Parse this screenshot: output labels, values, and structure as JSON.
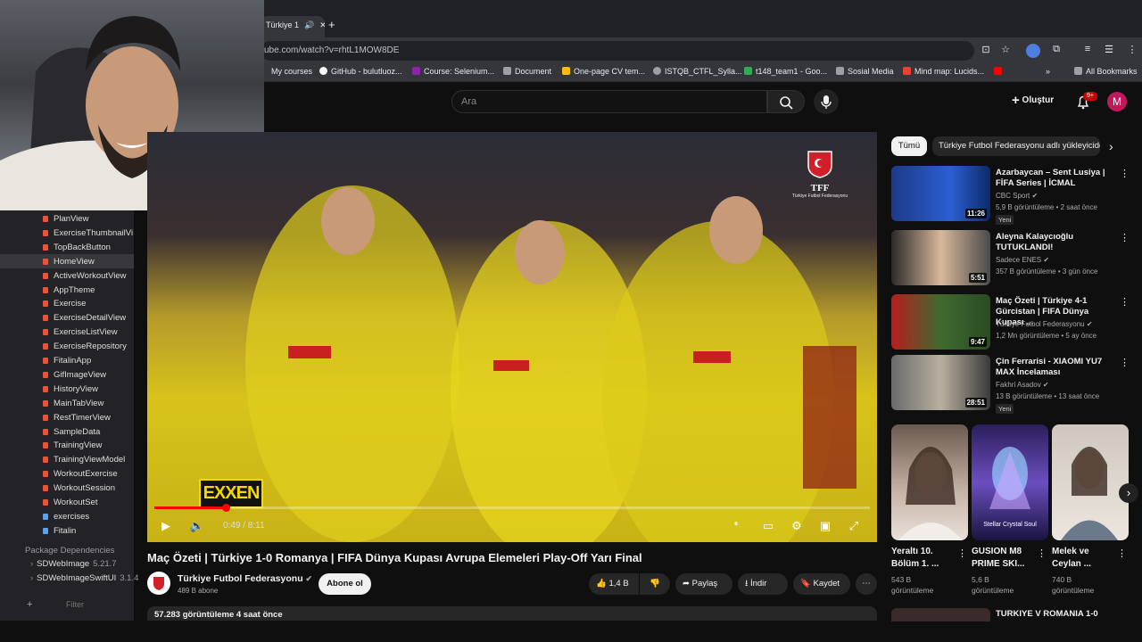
{
  "browser": {
    "tab": {
      "title": "Türkiye 1",
      "mute": "🔊",
      "close": "✕"
    },
    "new_tab": "+",
    "url": "ube.com/watch?v=rhtL1MOW8DE",
    "bookmarks": [
      {
        "label": "My courses",
        "color": "#5f6368"
      },
      {
        "label": "GitHub - bulutluoz...",
        "color": "#ffffff"
      },
      {
        "label": "Course: Selenium...",
        "color": "#8e24aa"
      },
      {
        "label": "Document",
        "color": "#5f6368"
      },
      {
        "label": "One-page CV tem...",
        "color": "#fbbc04"
      },
      {
        "label": "ISTQB_CTFL_Sylla...",
        "color": "#9aa0a6"
      },
      {
        "label": "t148_team1 - Goo...",
        "color": "#34a853"
      },
      {
        "label": "Sosial Media",
        "color": "#5f6368"
      },
      {
        "label": "Mind map: Lucids...",
        "color": "#ea4335"
      }
    ],
    "bookmarks_overflow": "»",
    "all_bookmarks": "All Bookmarks"
  },
  "youtube": {
    "search_placeholder": "Ara",
    "create_label": "Oluştur",
    "notifications_badge": "9+",
    "avatar_letter": "M"
  },
  "xcode": {
    "files": [
      {
        "name": "PlanView",
        "folder": false,
        "selected": false
      },
      {
        "name": "ExerciseThumbnailVi",
        "folder": false,
        "selected": false
      },
      {
        "name": "TopBackButton",
        "folder": false,
        "selected": false
      },
      {
        "name": "HomeView",
        "folder": false,
        "selected": true
      },
      {
        "name": "ActiveWorkoutView",
        "folder": false,
        "selected": false
      },
      {
        "name": "AppTheme",
        "folder": false,
        "selected": false
      },
      {
        "name": "Exercise",
        "folder": false,
        "selected": false
      },
      {
        "name": "ExerciseDetailView",
        "folder": false,
        "selected": false
      },
      {
        "name": "ExerciseListView",
        "folder": false,
        "selected": false
      },
      {
        "name": "ExerciseRepository",
        "folder": false,
        "selected": false
      },
      {
        "name": "FitalinApp",
        "folder": false,
        "selected": false
      },
      {
        "name": "GifImageView",
        "folder": false,
        "selected": false
      },
      {
        "name": "HistoryView",
        "folder": false,
        "selected": false
      },
      {
        "name": "MainTabView",
        "folder": false,
        "selected": false
      },
      {
        "name": "RestTimerView",
        "folder": false,
        "selected": false
      },
      {
        "name": "SampleData",
        "folder": false,
        "selected": false
      },
      {
        "name": "TrainingView",
        "folder": false,
        "selected": false
      },
      {
        "name": "TrainingViewModel",
        "folder": false,
        "selected": false
      },
      {
        "name": "WorkoutExercise",
        "folder": false,
        "selected": false
      },
      {
        "name": "WorkoutSession",
        "folder": false,
        "selected": false
      },
      {
        "name": "WorkoutSet",
        "folder": false,
        "selected": false
      },
      {
        "name": "exercises",
        "folder": true,
        "selected": false
      },
      {
        "name": "Fitalin",
        "folder": true,
        "selected": false
      }
    ],
    "package_header": "Package Dependencies",
    "packages": [
      {
        "name": "SDWebImage",
        "version": "5.21.7"
      },
      {
        "name": "SDWebImageSwiftUI",
        "version": "3.1.4"
      }
    ],
    "filter_placeholder": "Filter"
  },
  "video": {
    "overlay_logo": "EXXEN",
    "watermark_title": "TFF",
    "watermark_sub": "Türkiye Futbol Federasyonu",
    "progress_fraction": 0.1,
    "time": "0:49 / 8:11",
    "title": "Maç Özeti | Türkiye 1-0 Romanya | FIFA Dünya Kupası Avrupa Elemeleri Play-Off Yarı Final",
    "channel": "Türkiye Futbol Federasyonu",
    "subscribers": "489 B abone",
    "subscribe_label": "Abone ol",
    "likes": "1,4 B",
    "share_label": "Paylaş",
    "download_label": "İndir",
    "save_label": "Kaydet",
    "views_line": "57.283 görüntüleme  4 saat önce"
  },
  "chips": [
    "Tümü",
    "Türkiye Futbol Federasyonu adlı yükleyiciden"
  ],
  "recommendations": [
    {
      "title": "Azarbaycan – Sent Lusiya | FİFA Series | İCMAL",
      "channel": "CBC Sport",
      "meta": "5,9 B görüntüleme • 2 saat önce",
      "duration": "11:26",
      "badge": "Yeni"
    },
    {
      "title": "Aleyna Kalaycıoğlu TUTUKLANDI!",
      "channel": "Sadece ENES",
      "meta": "357 B görüntüleme • 3 gün önce",
      "duration": "5:51",
      "badge": ""
    },
    {
      "title": "Maç Özeti | Türkiye 4-1 Gürcistan | FIFA Dünya Kupası ...",
      "channel": "Türkiye Futbol Federasyonu",
      "meta": "1,2 Mn görüntüleme • 5 ay önce",
      "duration": "9:47",
      "badge": ""
    },
    {
      "title": "Çin Ferrarisi - XIAOMI YU7 MAX İncelaması",
      "channel": "Fakhri Asadov",
      "meta": "13 B görüntüleme • 13 saat önce",
      "duration": "28:51",
      "badge": "Yeni"
    }
  ],
  "shorts": [
    {
      "title": "Yeraltı 10. Bölüm 1. ...",
      "views": "543 B görüntüleme",
      "thumb_label": ""
    },
    {
      "title": "GUSION M8 PRIME SKI...",
      "views": "5,6 B görüntüleme",
      "thumb_label": "Stellar Crystal Soul"
    },
    {
      "title": "Melek ve Ceylan ...",
      "views": "740 B görüntüleme",
      "thumb_label": ""
    }
  ],
  "next_item_title": "TURKIYE V ROMANIA 1-0"
}
